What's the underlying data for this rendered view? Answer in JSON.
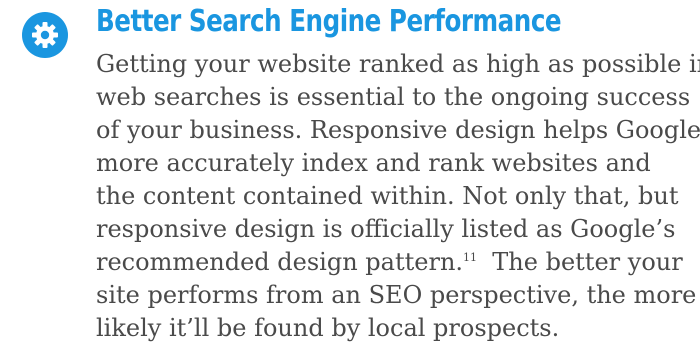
{
  "section": {
    "icon": "gear-icon",
    "accent_color": "#1a96e0",
    "heading": "Better Search Engine Performance",
    "paragraph_lines": [
      "Getting your website ranked as high as possible in",
      "web searches is essential to the ongoing success",
      "of your business. Responsive design helps Google",
      "more accurately index and rank websites and",
      "the content contained within. Not only that, but",
      "responsive design is officially listed as Google’s",
      "recommended design pattern.",
      "The better your",
      "site performs from an SEO perspective, the more",
      "likely it’ll be found by local prospects."
    ],
    "footnote_ref": "11"
  }
}
